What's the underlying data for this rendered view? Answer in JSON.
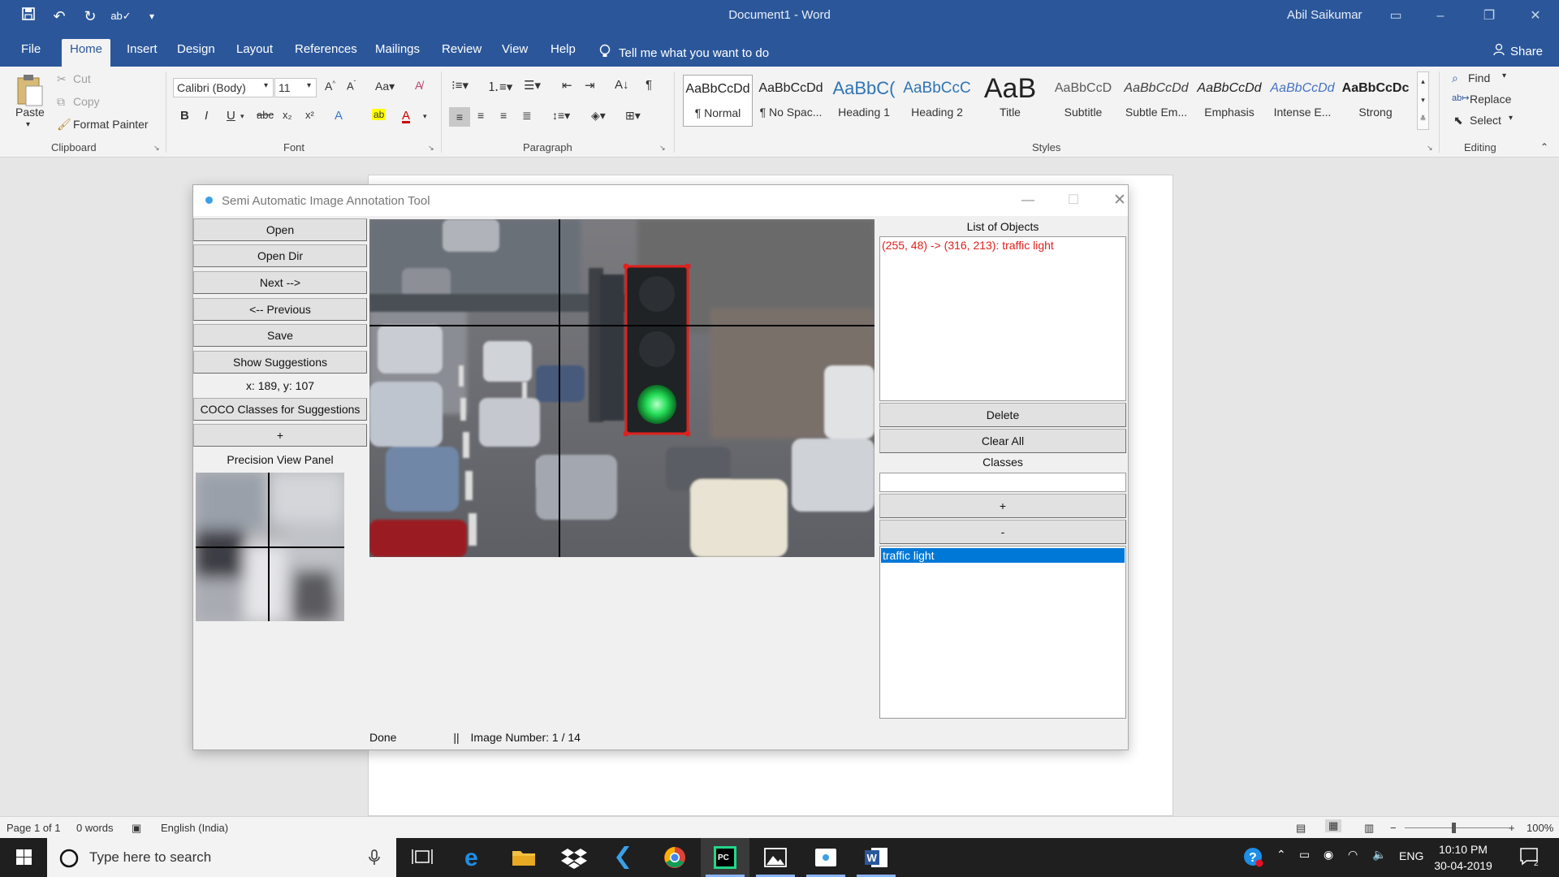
{
  "word": {
    "doc_title": "Document1  -  Word",
    "user": "Abil Saikumar",
    "tabs": [
      "File",
      "Home",
      "Insert",
      "Design",
      "Layout",
      "References",
      "Mailings",
      "Review",
      "View",
      "Help"
    ],
    "tell_me": "Tell me what you want to do",
    "share": "Share",
    "clipboard": {
      "paste": "Paste",
      "cut": "Cut",
      "copy": "Copy",
      "format_painter": "Format Painter",
      "label": "Clipboard"
    },
    "font": {
      "family": "Calibri (Body)",
      "size": "11",
      "label": "Font"
    },
    "paragraph_label": "Paragraph",
    "styles": {
      "label": "Styles",
      "items": [
        {
          "sample": "AaBbCcDd",
          "name": "¶ Normal"
        },
        {
          "sample": "AaBbCcDd",
          "name": "¶ No Spac..."
        },
        {
          "sample": "AaBbC(",
          "name": "Heading 1"
        },
        {
          "sample": "AaBbCcC",
          "name": "Heading 2"
        },
        {
          "sample": "AaB",
          "name": "Title"
        },
        {
          "sample": "AaBbCcD",
          "name": "Subtitle"
        },
        {
          "sample": "AaBbCcDd",
          "name": "Subtle Em..."
        },
        {
          "sample": "AaBbCcDd",
          "name": "Emphasis"
        },
        {
          "sample": "AaBbCcDd",
          "name": "Intense E..."
        },
        {
          "sample": "AaBbCcDc",
          "name": "Strong"
        }
      ]
    },
    "editing": {
      "find": "Find",
      "replace": "Replace",
      "select": "Select",
      "label": "Editing"
    },
    "status": {
      "page": "Page 1 of 1",
      "words": "0 words",
      "language": "English (India)",
      "zoom": "100%"
    }
  },
  "app": {
    "title": "Semi Automatic Image Annotation Tool",
    "buttons": {
      "open": "Open",
      "open_dir": "Open Dir",
      "next": "Next -->",
      "previous": "<-- Previous",
      "save": "Save",
      "show_suggestions": "Show Suggestions",
      "coco_classes": "COCO Classes for Suggestions",
      "plus": "+"
    },
    "coords": "x: 189, y: 107",
    "precision_label": "Precision View Panel",
    "right": {
      "list_label": "List of Objects",
      "objects": [
        "(255, 48) -> (316, 213): traffic light"
      ],
      "delete": "Delete",
      "clear_all": "Clear All",
      "classes_label": "Classes",
      "class_input": "",
      "add": "+",
      "remove": "-",
      "classes": [
        "traffic light"
      ]
    },
    "status": "Done",
    "separator": "||",
    "image_number": "Image Number: 1 / 14"
  },
  "taskbar": {
    "search_placeholder": "Type here to search",
    "language": "ENG",
    "time": "10:10 PM",
    "date": "30-04-2019",
    "notifications": "2"
  },
  "colors": {
    "word_blue": "#2b579a",
    "bbox_red": "#e0201c",
    "selection_blue": "#0078d7"
  }
}
